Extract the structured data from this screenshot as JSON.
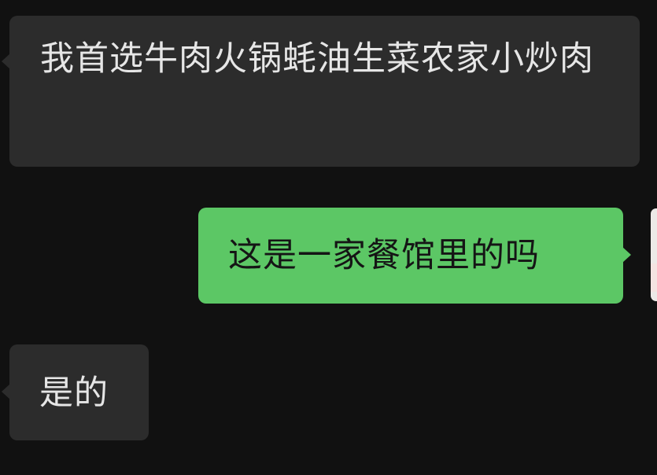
{
  "chat": {
    "messages": [
      {
        "direction": "incoming",
        "text": "我首选牛肉火锅蚝油生菜农家小炒肉"
      },
      {
        "direction": "outgoing",
        "text": "这是一家餐馆里的吗"
      },
      {
        "direction": "incoming",
        "text": "是的"
      }
    ]
  },
  "colors": {
    "background": "#111111",
    "incoming_bubble": "#2c2c2c",
    "outgoing_bubble": "#5cc765",
    "incoming_text": "#e6e6e6",
    "outgoing_text": "#151515"
  }
}
